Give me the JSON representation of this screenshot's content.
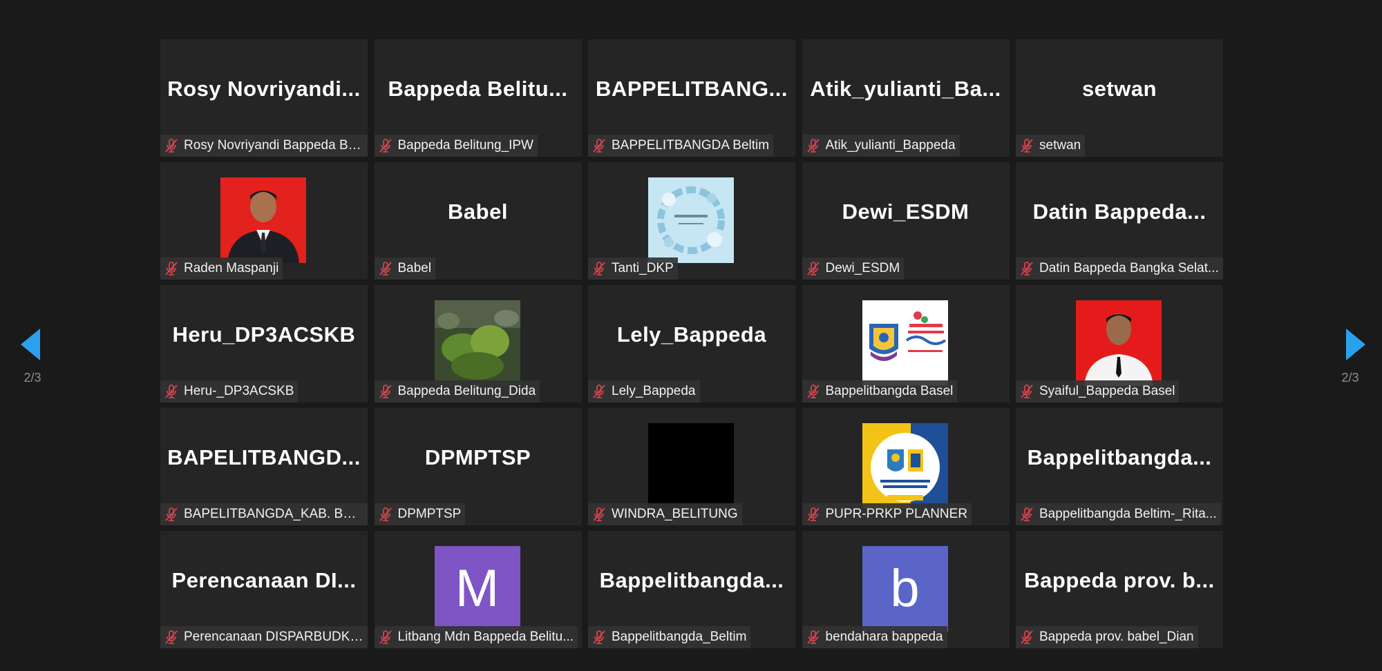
{
  "pagination": {
    "current_left": "2/3",
    "current_right": "2/3"
  },
  "colors": {
    "accent": "#2aa1ee",
    "muted_mic": "#d9414b",
    "tile_bg": "#252525"
  },
  "tiles": [
    {
      "big_name": "Rosy Novriyandi...",
      "label": "Rosy Novriyandi Bappeda Ba..."
    },
    {
      "big_name": "Bappeda Belitu...",
      "label": "Bappeda Belitung_IPW"
    },
    {
      "big_name": "BAPPELITBANG...",
      "label": "BAPPELITBANGDA Beltim"
    },
    {
      "big_name": "Atik_yulianti_Ba...",
      "label": "Atik_yulianti_Bappeda"
    },
    {
      "big_name": "setwan",
      "label": "setwan"
    },
    {
      "avatar": "portrait-photo-red-bg",
      "label": "Raden Maspanji"
    },
    {
      "big_name": "Babel",
      "label": "Babel"
    },
    {
      "avatar": "floral-wreath-image",
      "label": "Tanti_DKP"
    },
    {
      "big_name": "Dewi_ESDM",
      "label": "Dewi_ESDM"
    },
    {
      "big_name": "Datin Bappeda...",
      "label": "Datin Bappeda Bangka Selat..."
    },
    {
      "big_name": "Heru_DP3ACSKB",
      "label": "Heru-_DP3ACSKB"
    },
    {
      "avatar": "foliage-photo",
      "label": "Bappeda Belitung_Dida"
    },
    {
      "big_name": "Lely_Bappeda",
      "label": "Lely_Bappeda"
    },
    {
      "avatar": "bangka-selatan-logo",
      "label": "Bappelitbangda Basel"
    },
    {
      "avatar": "portrait-photo-red-bg-2",
      "label": "Syaiful_Bappeda Basel"
    },
    {
      "big_name": "BAPELITBANGD...",
      "label": "BAPELITBANGDA_KAB. BELTI..."
    },
    {
      "big_name": "DPMPTSP",
      "label": "DPMPTSP"
    },
    {
      "avatar": "black-square",
      "label": "WINDRA_BELITUNG"
    },
    {
      "avatar": "dinas-pupr-logo",
      "label": "PUPR-PRKP PLANNER"
    },
    {
      "big_name": "Bappelitbangda...",
      "label": "Bappelitbangda Beltim-_Rita..."
    },
    {
      "big_name": "Perencanaan DI...",
      "label": "Perencanaan DISPARBUDKE..."
    },
    {
      "avatar_letter": "M",
      "avatar_color": "#7f55c5",
      "label": "Litbang Mdn Bappeda Belitu..."
    },
    {
      "big_name": "Bappelitbangda...",
      "label": "Bappelitbangda_Beltim"
    },
    {
      "avatar_letter": "b",
      "avatar_color": "#5b65c8",
      "label": "bendahara bappeda"
    },
    {
      "big_name": "Bappeda prov. b...",
      "label": "Bappeda prov. babel_Dian"
    }
  ]
}
